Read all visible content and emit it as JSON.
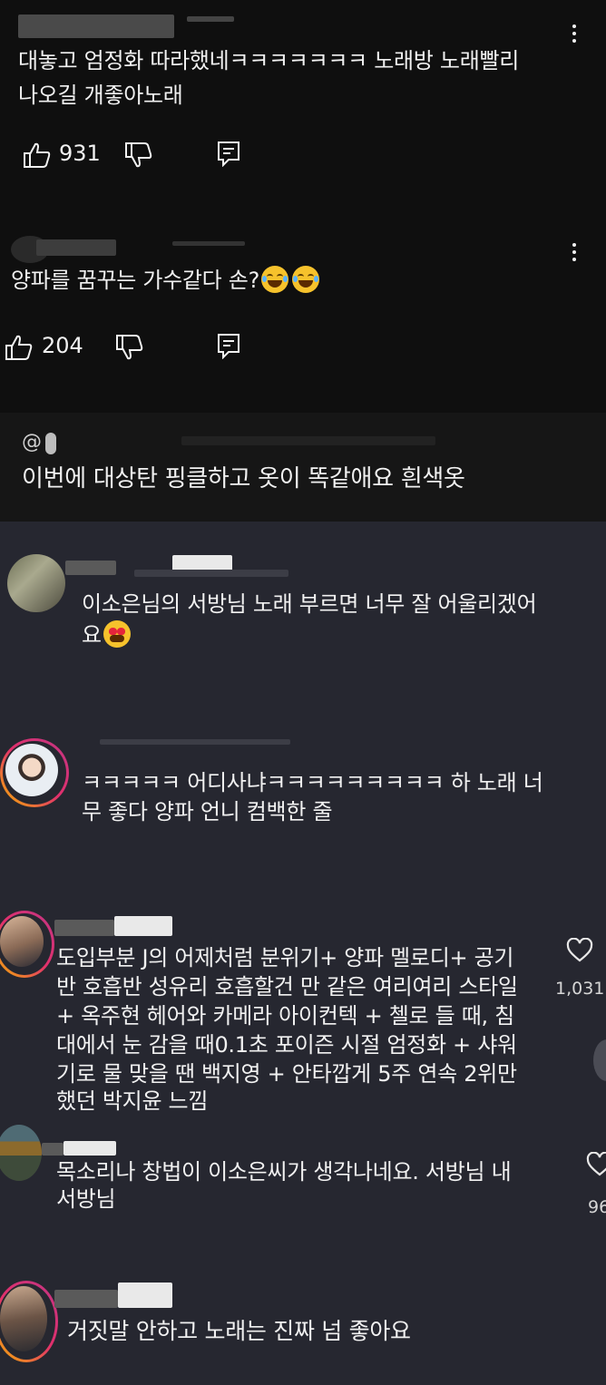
{
  "youtube_comments": [
    {
      "text_line1": "대놓고 엄정화 따라했네ㅋㅋㅋㅋㅋㅋㅋ 노래방 노래빨리",
      "text_line2": "나오길 개좋아노래",
      "likes": "931"
    },
    {
      "text_line1": "양파를 꿈꾸는 가수같다 손?",
      "likes": "204"
    }
  ],
  "reply_preview": {
    "mention": "@",
    "text": "이번에 대상탄 핑클하고 옷이 똑같애요 흰색옷"
  },
  "instagram_comments": [
    {
      "text_line1": "이소은님의 서방님 노래 부르면 너무 잘 어울리겠어",
      "text_line2": "요"
    },
    {
      "text_line1": "ㅋㅋㅋㅋㅋ 어디사냐ㅋㅋㅋㅋㅋㅋㅋㅋㅋ 하 노래 너",
      "text_line2": "무 좋다 양파 언니 컴백한 줄"
    },
    {
      "text_lines": [
        "도입부분 J의 어제처럼 분위기+ 양파 멜로디+ 공기",
        "반 호흡반 성유리 호흡할건 만 같은 여리여리 스타일",
        "+ 옥주현 헤어와 카메라 아이컨텍 + 첼로 들 때, 침",
        "대에서 눈 감을 때0.1초 포이즌 시절 엄정화 + 샤워",
        "기로 물 맞을 땐 백지영 + 안타깝게 5주 연속 2위만",
        "했던 박지윤 느낌"
      ],
      "likes": "1,031"
    },
    {
      "text_line1": "목소리나 창법이 이소은씨가 생각나네요. 서방님 내",
      "text_line2": "서방님",
      "likes": "96"
    },
    {
      "text_line1": "거짓말 안하고 노래는 진짜 넘 좋아요"
    }
  ],
  "icons": [
    "like-icon",
    "dislike-icon",
    "reply-icon",
    "more-icon",
    "heart-icon",
    "laugh-emoji",
    "heart-eyes-emoji"
  ],
  "colors": {
    "youtube_bg": "#0f0f0f",
    "instagram_bg": "#262730",
    "text": "#f1f1f1"
  }
}
